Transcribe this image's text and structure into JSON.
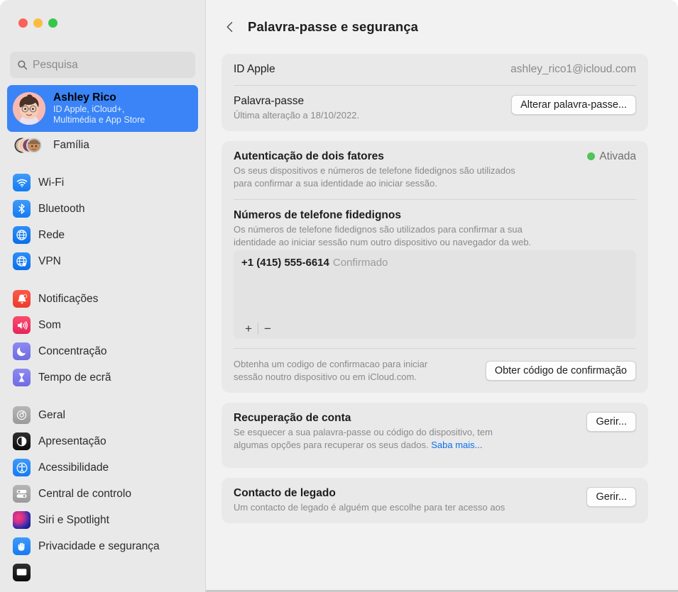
{
  "window": {
    "traffic_lights": [
      "close",
      "minimize",
      "maximize"
    ],
    "colors": {
      "close": "#fc6058",
      "minimize": "#fdbc40",
      "maximize": "#34c84a",
      "accent": "#3a84f7",
      "status_on": "#4ec45a",
      "link": "#0a6ff0"
    }
  },
  "sidebar": {
    "search": {
      "placeholder": "Pesquisa",
      "value": "",
      "icon": "search-icon"
    },
    "account": {
      "name": "Ashley Rico",
      "subtitle_line1": "ID Apple, iCloud+,",
      "subtitle_line2": "Multimédia e App Store",
      "avatar": "memoji-avatar",
      "selected": true
    },
    "family": {
      "label": "Família",
      "icon": "family-memoji-icon"
    },
    "groups": [
      {
        "items": [
          {
            "label": "Wi-Fi",
            "icon": "wifi-icon"
          },
          {
            "label": "Bluetooth",
            "icon": "bluetooth-icon"
          },
          {
            "label": "Rede",
            "icon": "network-globe-icon"
          },
          {
            "label": "VPN",
            "icon": "vpn-globe-icon"
          }
        ]
      },
      {
        "items": [
          {
            "label": "Notificações",
            "icon": "notifications-bell-icon"
          },
          {
            "label": "Som",
            "icon": "sound-speaker-icon"
          },
          {
            "label": "Concentração",
            "icon": "focus-moon-icon"
          },
          {
            "label": "Tempo de ecrã",
            "icon": "screen-time-hourglass-icon"
          }
        ]
      },
      {
        "items": [
          {
            "label": "Geral",
            "icon": "general-gear-icon"
          },
          {
            "label": "Apresentação",
            "icon": "appearance-icon"
          },
          {
            "label": "Acessibilidade",
            "icon": "accessibility-icon"
          },
          {
            "label": "Central de controlo",
            "icon": "control-center-icon"
          },
          {
            "label": "Siri e Spotlight",
            "icon": "siri-icon"
          },
          {
            "label": "Privacidade e segurança",
            "icon": "privacy-hand-icon"
          }
        ]
      }
    ]
  },
  "main": {
    "back_icon": "chevron-left-icon",
    "title": "Palavra-passe e segurança",
    "account_card": {
      "apple_id_label": "ID Apple",
      "apple_id_value": "ashley_rico1@icloud.com",
      "password_label": "Palavra-passe",
      "password_sub": "Última alteração a 18/10/2022.",
      "change_password_button": "Alterar palavra-passe..."
    },
    "two_factor_card": {
      "title": "Autenticação de dois fatores",
      "status": "Ativada",
      "description_line1": "Os seus dispositivos e números de telefone fidedignos são utilizados",
      "description_line2": "para confirmar a sua identidade ao iniciar sessão.",
      "phones_title": "Números de telefone fidedignos",
      "phones_description_line1": "Os números de telefone fidedignos são utilizados para confirmar a sua",
      "phones_description_line2": "identidade ao iniciar sessão num outro dispositivo ou navegador da web.",
      "phones": [
        {
          "number": "+1 (415) 555-6614",
          "state": "Confirmado"
        }
      ],
      "add_button": "+",
      "remove_button": "−",
      "code_description_line1": "Obtenha um codigo de confirmacao para iniciar",
      "code_description_line2": "sessão noutro dispositivo ou em  iCloud.com.",
      "code_button": "Obter código de confirmação"
    },
    "account_recovery_card": {
      "title": "Recuperação de conta",
      "manage_button": "Gerir...",
      "description_line1": "Se esquecer a sua palavra-passe ou código do dispositivo, tem",
      "description_line2": "algumas opções para recuperar os seus dados. ",
      "learn_more": "Saba mais..."
    },
    "legacy_contact_card": {
      "title": "Contacto de legado",
      "manage_button": "Gerir...",
      "description_line1": "Um contacto de legado é alguém que escolhe para ter acesso aos"
    }
  }
}
